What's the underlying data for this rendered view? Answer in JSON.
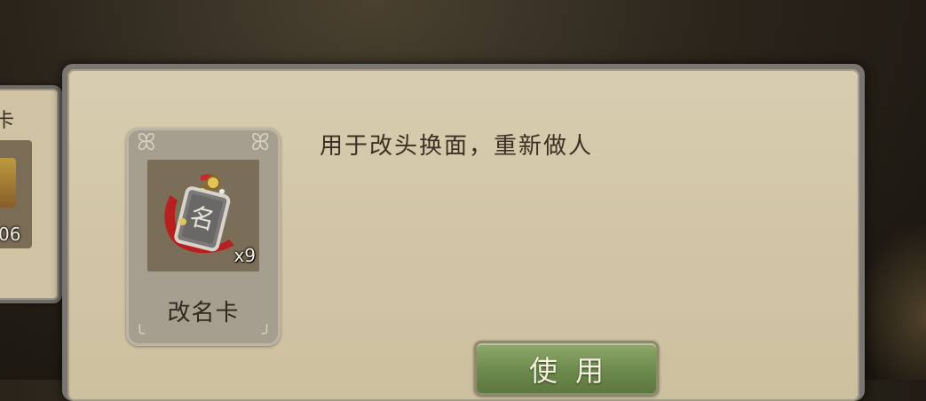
{
  "left_card": {
    "label": "卡",
    "count": "06"
  },
  "item": {
    "name": "改名卡",
    "count": "x9",
    "glyph": "名",
    "icon": "rename-card-icon"
  },
  "description": "用于改头换面，重新做人",
  "use_button": {
    "label": "使用"
  },
  "colors": {
    "panel_bg": "#d1c5a6",
    "panel_border": "#7a7570",
    "card_bg": "#a69f8f",
    "button_green": "#6d8a4d",
    "text_dark": "#3a3024"
  }
}
